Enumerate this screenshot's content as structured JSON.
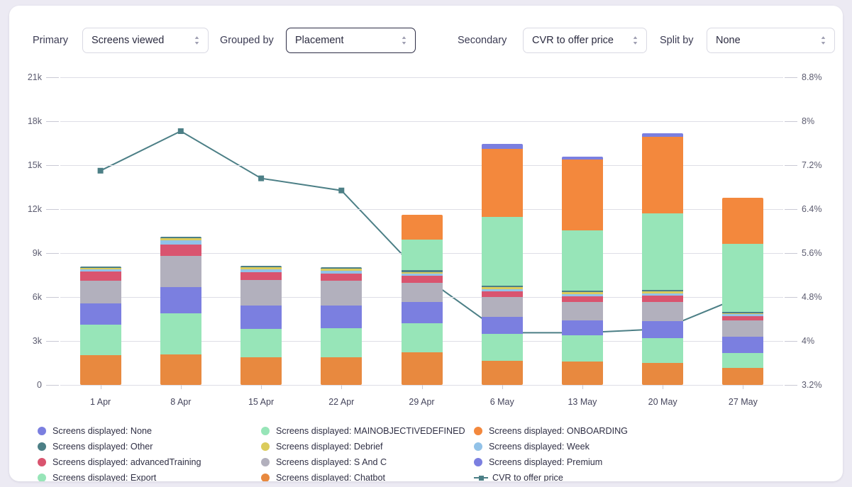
{
  "toolbar": {
    "controls": [
      {
        "label": "Primary",
        "value": "Screens viewed",
        "name": "primary",
        "focused": false
      },
      {
        "label": "Grouped by",
        "value": "Placement",
        "name": "grouped-by",
        "focused": true
      },
      {
        "label": "Secondary",
        "value": "CVR to offer price",
        "name": "secondary",
        "focused": false
      },
      {
        "label": "Split by",
        "value": "None",
        "name": "split-by",
        "focused": false
      }
    ]
  },
  "chart_data": {
    "type": "bar",
    "title": "",
    "xlabel": "",
    "ylabel": "Screens viewed",
    "y2label": "CVR to offer price",
    "stacked": true,
    "grid": true,
    "legend_position": "bottom",
    "categories": [
      "1 Apr",
      "8 Apr",
      "15 Apr",
      "22 Apr",
      "29 Apr",
      "6 May",
      "13 May",
      "20 May",
      "27 May"
    ],
    "ylim": [
      0,
      21000
    ],
    "yticks": [
      "0",
      "3k",
      "6k",
      "9k",
      "12k",
      "15k",
      "18k",
      "21k"
    ],
    "ytick_values": [
      0,
      3000,
      6000,
      9000,
      12000,
      15000,
      18000,
      21000
    ],
    "y2lim": [
      3.2,
      8.8
    ],
    "y2ticks": [
      "3.2%",
      "4%",
      "4.8%",
      "5.6%",
      "6.4%",
      "7.2%",
      "8%",
      "8.8%"
    ],
    "y2tick_values": [
      3.2,
      4.0,
      4.8,
      5.6,
      6.4,
      7.2,
      8.0,
      8.8
    ],
    "series": [
      {
        "name": "Screens displayed: Chatbot",
        "color": "#e8893f",
        "values": [
          2050,
          2100,
          1900,
          1900,
          2250,
          1650,
          1600,
          1500,
          1150
        ]
      },
      {
        "name": "Screens displayed: Export",
        "color": "#97e5b8",
        "values": [
          2050,
          2800,
          1900,
          1950,
          1950,
          1850,
          1800,
          1700,
          1050
        ]
      },
      {
        "name": "Screens displayed: Premium",
        "color": "#7b7fe0",
        "values": [
          1450,
          1800,
          1600,
          1550,
          1450,
          1150,
          1000,
          1150,
          1100
        ]
      },
      {
        "name": "Screens displayed: S And C",
        "color": "#b2b0bd",
        "values": [
          1550,
          2100,
          1750,
          1700,
          1300,
          1350,
          1250,
          1300,
          1100
        ]
      },
      {
        "name": "Screens displayed: advancedTraining",
        "color": "#d9546f",
        "values": [
          650,
          800,
          550,
          500,
          500,
          400,
          400,
          450,
          300
        ]
      },
      {
        "name": "Screens displayed: Week",
        "color": "#92c2e8",
        "values": [
          150,
          250,
          200,
          200,
          150,
          150,
          150,
          150,
          120
        ]
      },
      {
        "name": "Screens displayed: Debrief",
        "color": "#dbcc5c",
        "values": [
          100,
          150,
          150,
          150,
          120,
          120,
          120,
          120,
          80
        ]
      },
      {
        "name": "Screens displayed: Other",
        "color": "#4c7f86",
        "values": [
          80,
          100,
          100,
          100,
          100,
          100,
          100,
          100,
          70
        ]
      },
      {
        "name": "Screens displayed: MAINOBJECTIVEDEFINED",
        "color": "#97e5b8",
        "values": [
          0,
          0,
          0,
          0,
          2100,
          4700,
          4150,
          5250,
          4650
        ]
      },
      {
        "name": "Screens displayed: ONBOARDING",
        "color": "#f3883d",
        "values": [
          0,
          0,
          0,
          0,
          1700,
          4650,
          4800,
          5200,
          3150
        ]
      },
      {
        "name": "Screens displayed: None",
        "color": "#7b7fe0",
        "values": [
          0,
          0,
          0,
          0,
          0,
          350,
          200,
          250,
          0
        ]
      }
    ],
    "line_series": {
      "name": "CVR to offer price",
      "color": "#4c7f86",
      "axis": "right",
      "marker": "square",
      "values": [
        7.1,
        7.82,
        6.96,
        6.74,
        5.2,
        4.15,
        4.15,
        4.22,
        4.82
      ]
    }
  },
  "legend": {
    "items": [
      {
        "label": "Screens displayed: None",
        "color": "#7b7fe0",
        "type": "dot"
      },
      {
        "label": "Screens displayed: Other",
        "color": "#4c7f86",
        "type": "dot"
      },
      {
        "label": "Screens displayed: advancedTraining",
        "color": "#d9546f",
        "type": "dot"
      },
      {
        "label": "Screens displayed: Export",
        "color": "#97e5b8",
        "type": "dot"
      },
      {
        "label": "Screens displayed: MAINOBJECTIVEDEFINED",
        "color": "#97e5b8",
        "type": "dot"
      },
      {
        "label": "Screens displayed: Debrief",
        "color": "#dbcc5c",
        "type": "dot"
      },
      {
        "label": "Screens displayed: S And C",
        "color": "#b2b0bd",
        "type": "dot"
      },
      {
        "label": "Screens displayed: Chatbot",
        "color": "#e8893f",
        "type": "dot"
      },
      {
        "label": "Screens displayed: ONBOARDING",
        "color": "#f3883d",
        "type": "dot"
      },
      {
        "label": "Screens displayed: Week",
        "color": "#92c2e8",
        "type": "dot"
      },
      {
        "label": "Screens displayed: Premium",
        "color": "#7b7fe0",
        "type": "dot"
      },
      {
        "label": "CVR to offer price",
        "color": "#4c7f86",
        "type": "line"
      }
    ]
  }
}
